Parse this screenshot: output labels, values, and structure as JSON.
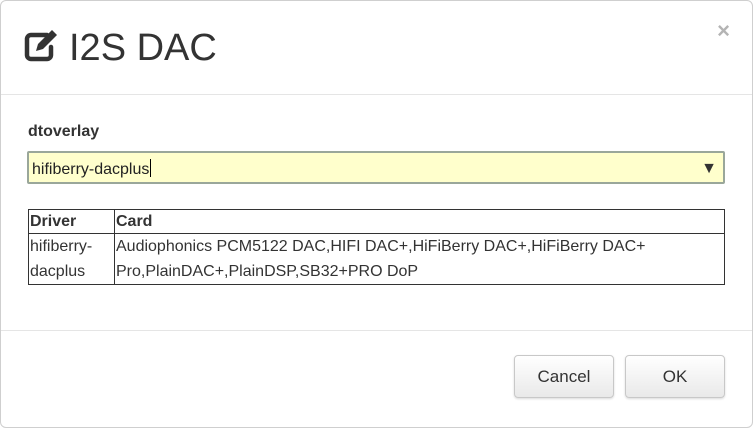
{
  "dialog": {
    "title": "I2S DAC",
    "title_icon": "edit-icon",
    "close_label": "×"
  },
  "form": {
    "dtoverlay_label": "dtoverlay",
    "dtoverlay_value": "hifiberry-dacplus",
    "dropdown_arrow": "▼",
    "input_bg_color": "#ffffcc"
  },
  "table": {
    "headers": [
      "Driver",
      "Card"
    ],
    "rows": [
      {
        "driver": "hifiberry-dacplus",
        "card": "Audiophonics PCM5122 DAC,HIFI DAC+,HiFiBerry DAC+,HiFiBerry DAC+ Pro,PlainDAC+,PlainDSP,SB32+PRO DoP"
      }
    ]
  },
  "footer": {
    "cancel_label": "Cancel",
    "ok_label": "OK"
  }
}
